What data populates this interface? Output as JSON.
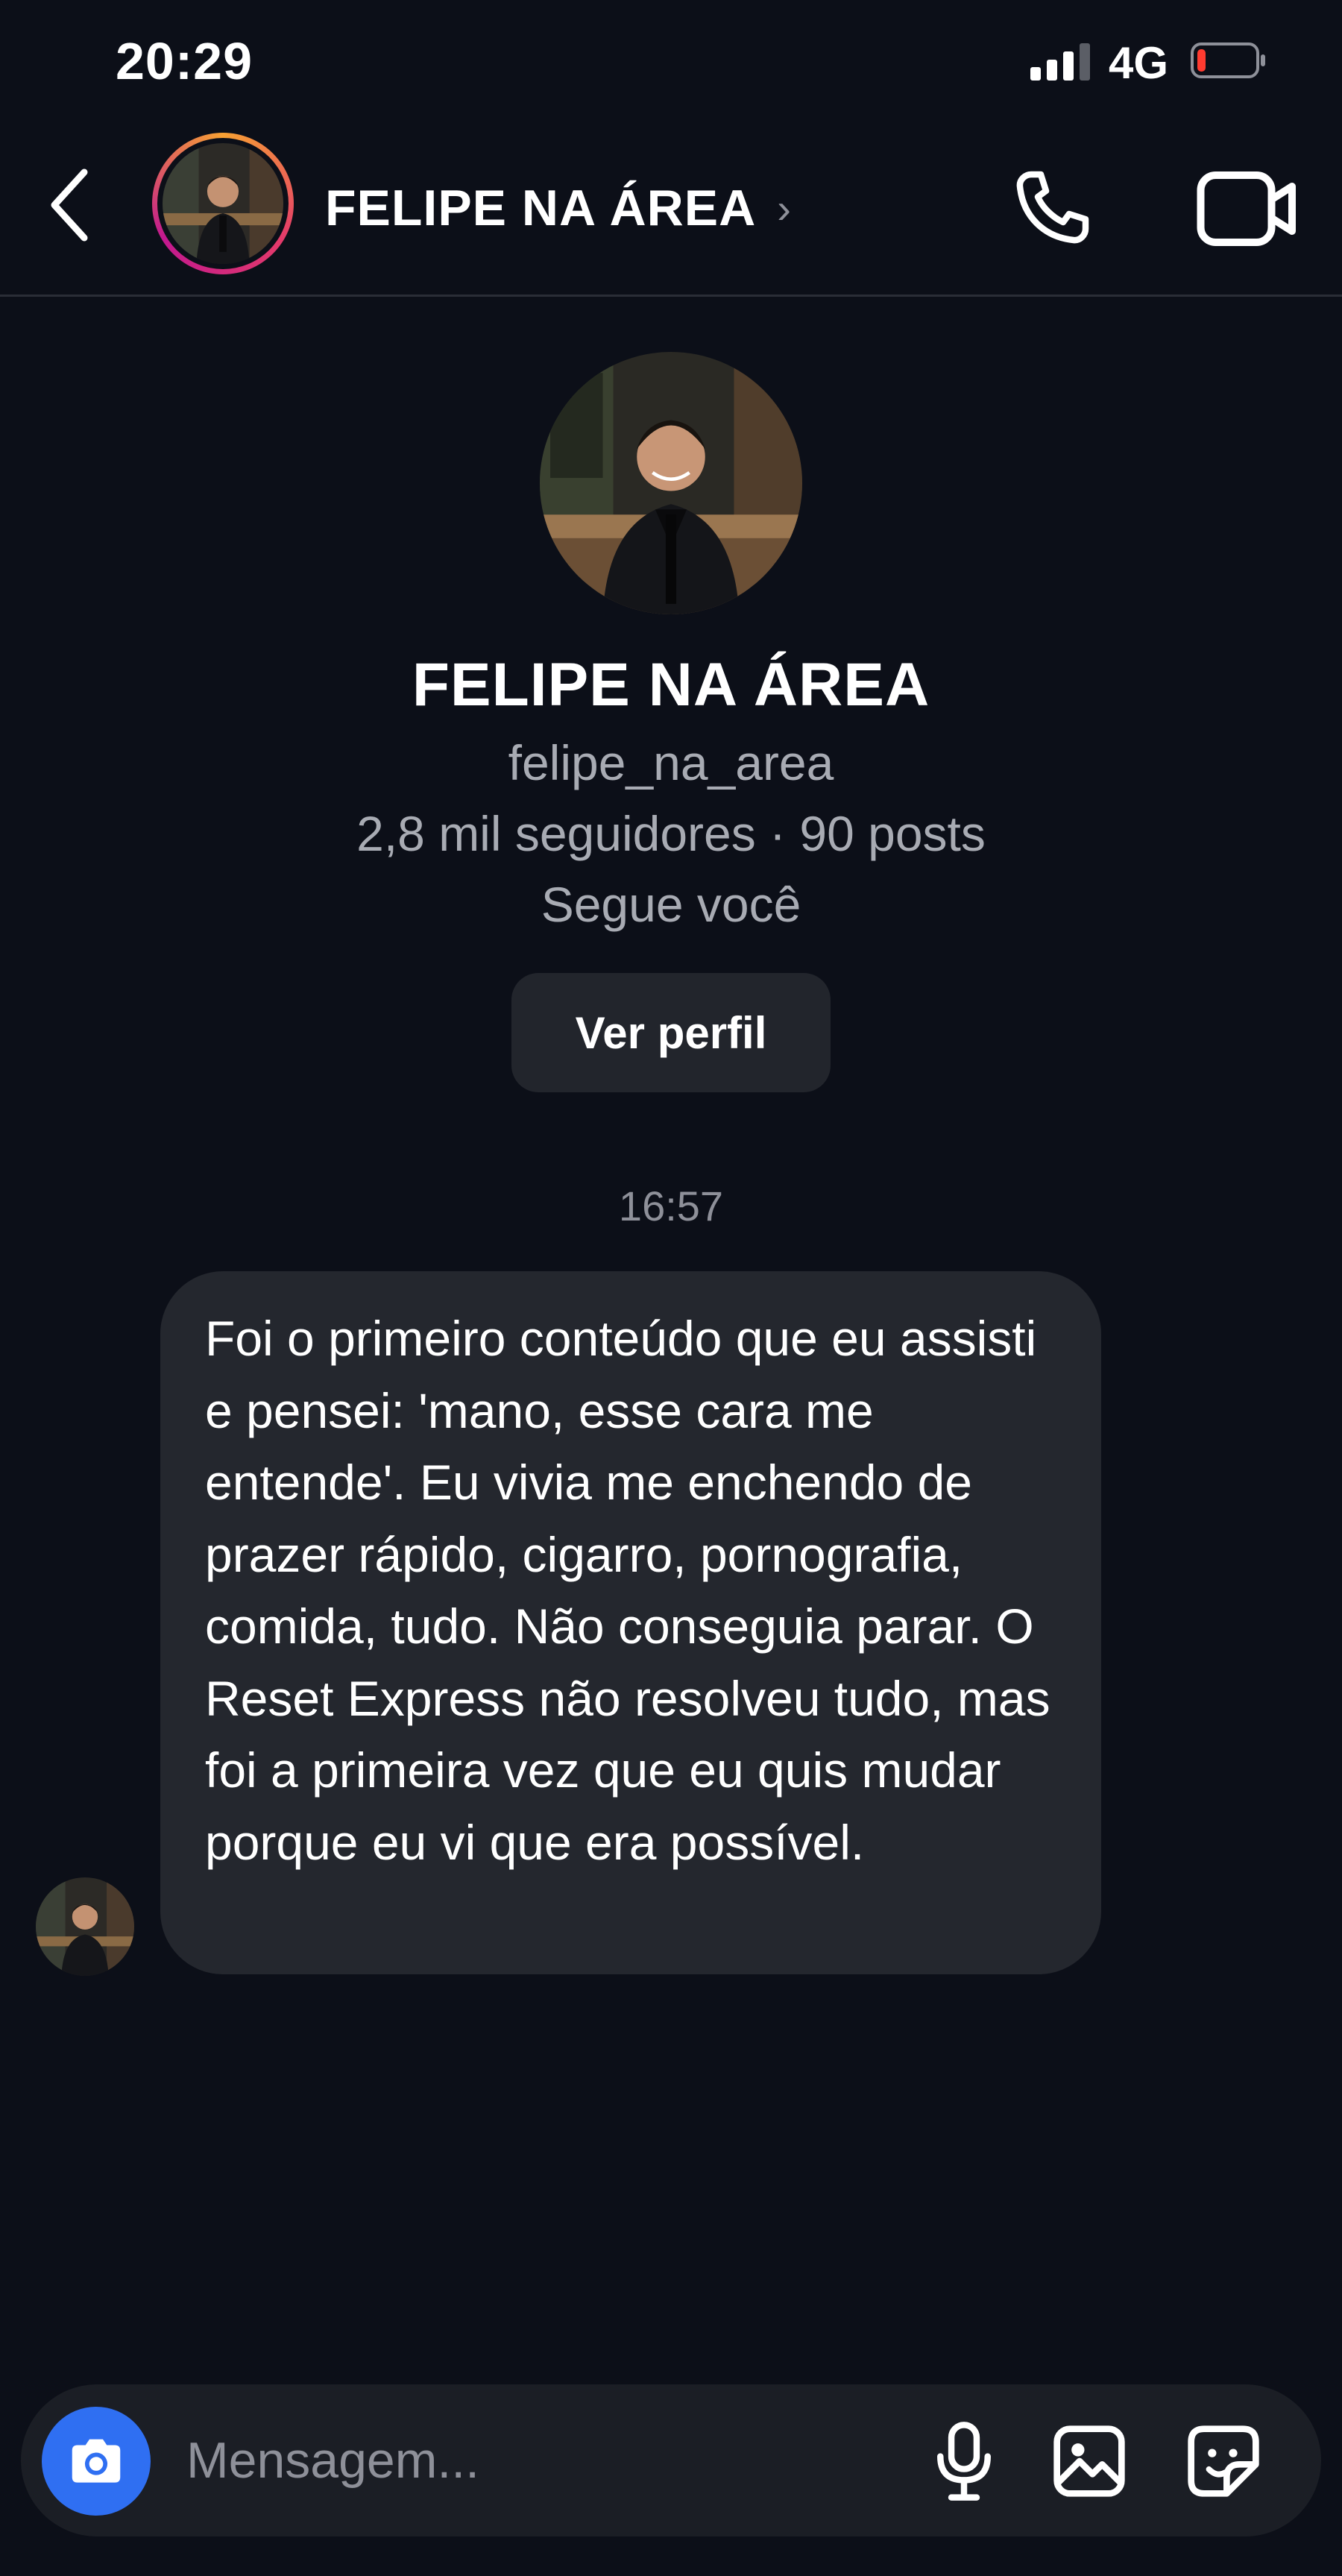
{
  "status_bar": {
    "time": "20:29",
    "network": "4G",
    "signal_icon": "cellular-signal-icon",
    "battery_icon": "battery-low-icon",
    "battery_level": 0.15,
    "battery_color": "#ff3b30"
  },
  "header": {
    "back_icon": "chevron-left-icon",
    "name": "FELIPE NA ÁREA",
    "chevron": "›",
    "call_icon": "phone-icon",
    "video_icon": "video-camera-icon"
  },
  "profile": {
    "name": "FELIPE NA ÁREA",
    "username": "felipe_na_area",
    "stats": "2,8 mil seguidores · 90 posts",
    "follows": "Segue você",
    "view_profile_label": "Ver perfil"
  },
  "conversation": {
    "timestamp": "16:57",
    "messages": [
      {
        "direction": "incoming",
        "text": "Foi o primeiro conteúdo que eu assisti e pensei: 'mano, esse cara me entende'. Eu vivia me enchendo de prazer rápido, cigarro, pornografia, comida, tudo. Não conseguia parar. O Reset Express não resolveu tudo, mas foi a primeira vez que eu quis mudar porque eu vi que era possível."
      }
    ]
  },
  "composer": {
    "camera_icon": "camera-icon",
    "placeholder": "Mensagem...",
    "value": "",
    "mic_icon": "microphone-icon",
    "gallery_icon": "gallery-image-icon",
    "sticker_icon": "sticker-icon"
  },
  "colors": {
    "background": "#0c0f18",
    "bubble": "#24272e",
    "accent_blue": "#2f6ff2",
    "story_ring_start": "#f7a133",
    "story_ring_end": "#c2188f",
    "muted_text": "#a8abb3"
  }
}
